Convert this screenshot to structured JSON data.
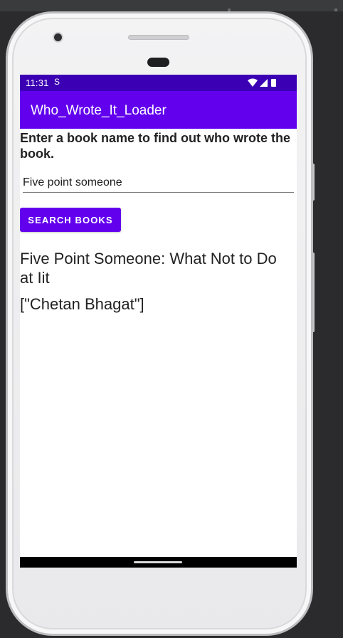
{
  "status_bar": {
    "time": "11:31",
    "sim_glyph": "S",
    "icons": [
      "wifi-icon",
      "cellular-signal-icon",
      "battery-icon"
    ]
  },
  "app_bar": {
    "title": "Who_Wrote_It_Loader"
  },
  "main": {
    "prompt": "Enter a book name to find out who wrote the book.",
    "book_input_value": "Five point someone",
    "search_button_label": "SEARCH BOOKS",
    "result_title": "Five Point Someone: What Not to Do at Iit",
    "result_authors": "[\"Chetan Bhagat\"]"
  },
  "colors": {
    "status_bar": "#3b00b3",
    "app_bar": "#6200ee",
    "button": "#6200ee"
  }
}
